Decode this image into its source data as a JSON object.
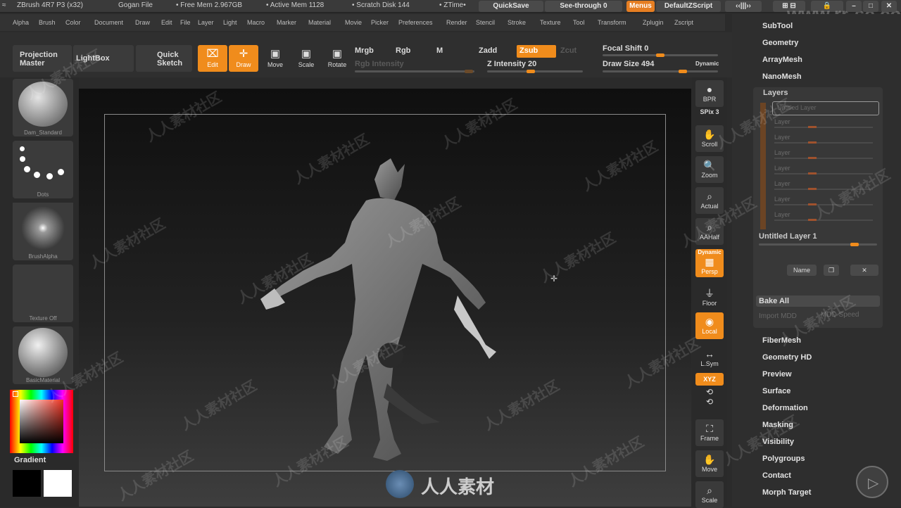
{
  "title_bar": {
    "app": "ZBrush 4R7 P3 (x32)",
    "file": "Gogan File",
    "free_mem": "• Free Mem 2.967GB",
    "active_mem": "• Active Mem 1128",
    "scratch": "• Scratch Disk 144",
    "ztime": "• ZTime•",
    "quicksave": "QuickSave",
    "seethrough": "See-through  0",
    "menus": "Menus",
    "zscript": "DefaultZScript",
    "site": "www.rr-sc.com"
  },
  "menubar": [
    "Alpha",
    "Brush",
    "Color",
    "Document",
    "Draw",
    "Edit",
    "File",
    "Layer",
    "Light",
    "Macro",
    "Marker",
    "Material",
    "Movie",
    "Picker",
    "Preferences",
    "Render",
    "Stencil",
    "Stroke",
    "Texture",
    "Tool",
    "Transform",
    "Zplugin",
    "Zscript"
  ],
  "shelf": {
    "projection_master": "Projection Master",
    "lightbox": "LightBox",
    "quick_sketch": "Quick Sketch",
    "edit": "Edit",
    "draw": "Draw",
    "move": "Move",
    "scale": "Scale",
    "rotate": "Rotate",
    "mrgb": "Mrgb",
    "rgb": "Rgb",
    "m": "M",
    "rgb_intensity": "Rgb Intensity",
    "zadd": "Zadd",
    "zsub": "Zsub",
    "zcut": "Zcut",
    "z_intensity": "Z Intensity 20",
    "focal_shift": "Focal Shift 0",
    "draw_size": "Draw Size 494",
    "dynamic": "Dynamic"
  },
  "left_tray": {
    "brush": "Dam_Standard",
    "stroke": "Dots",
    "alpha": "BrushAlpha",
    "texture": "Texture Off",
    "material": "BasicMaterial",
    "gradient": "Gradient"
  },
  "right_tray": {
    "bpr": "BPR",
    "spix": "SPix 3",
    "scroll": "Scroll",
    "zoom": "Zoom",
    "actual": "Actual",
    "aahalf": "AAHalf",
    "dynamic": "Dynamic",
    "persp": "Persp",
    "floor": "Floor",
    "local": "Local",
    "lsym": "L.Sym",
    "xyz": "XYZ",
    "frame": "Frame",
    "move": "Move",
    "scale": "Scale"
  },
  "palette": {
    "top_items": [
      "SubTool",
      "Geometry",
      "ArrayMesh",
      "NanoMesh"
    ],
    "layers_title": "Layers",
    "layer_input": "Untitled Layer",
    "layer_rows": [
      "Layer",
      "Layer",
      "Layer",
      "Layer",
      "Layer",
      "Layer",
      "Layer"
    ],
    "active_layer": "Untitled Layer 1",
    "name_btn": "Name",
    "bake_all": "Bake All",
    "import_mdd": "Import MDD",
    "mdd_speed": "MDD Speed",
    "bottom_items": [
      "FiberMesh",
      "Geometry HD",
      "Preview",
      "Surface",
      "Deformation",
      "Masking",
      "Visibility",
      "Polygroups",
      "Contact",
      "Morph Target"
    ]
  },
  "watermark": "人人素材社区",
  "logo_text": "人人素材",
  "colors": {
    "accent": "#f08c1c",
    "bg": "#2b2b2b"
  }
}
